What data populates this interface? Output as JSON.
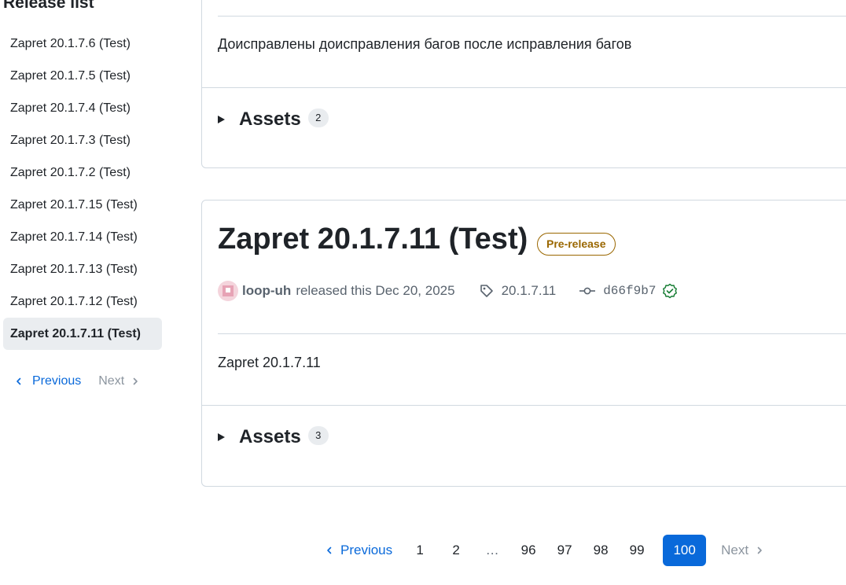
{
  "sidebar": {
    "title": "Release list",
    "items": [
      {
        "label": "Zapret 20.1.7.6 (Test)"
      },
      {
        "label": "Zapret 20.1.7.5 (Test)"
      },
      {
        "label": "Zapret 20.1.7.4 (Test)"
      },
      {
        "label": "Zapret 20.1.7.3 (Test)"
      },
      {
        "label": "Zapret 20.1.7.2 (Test)"
      },
      {
        "label": "Zapret 20.1.7.15 (Test)"
      },
      {
        "label": "Zapret 20.1.7.14 (Test)"
      },
      {
        "label": "Zapret 20.1.7.13 (Test)"
      },
      {
        "label": "Zapret 20.1.7.12 (Test)"
      },
      {
        "label": "Zapret 20.1.7.11 (Test)"
      }
    ],
    "selected_index": 9,
    "previous_label": "Previous",
    "next_label": "Next"
  },
  "release_prev": {
    "notes": "Доисправлены доисправления багов после исправления багов",
    "assets_label": "Assets",
    "assets_count": "2"
  },
  "release_current": {
    "title": "Zapret 20.1.7.11 (Test)",
    "badge": "Pre-release",
    "author": "loop-uh",
    "released_text": "released this Dec 20, 2025",
    "tag": "20.1.7.11",
    "commit": "d66f9b7",
    "notes": "Zapret 20.1.7.11",
    "assets_label": "Assets",
    "assets_count": "3"
  },
  "pagination": {
    "previous_label": "Previous",
    "pages": [
      "1",
      "2"
    ],
    "gap": "…",
    "tail_pages": [
      "96",
      "97",
      "98",
      "99"
    ],
    "current": "100",
    "next_label": "Next"
  },
  "colors": {
    "link": "#0969da",
    "prerelease": "#9a6700",
    "verified": "#1a7f37",
    "border": "#d1d9e0"
  }
}
